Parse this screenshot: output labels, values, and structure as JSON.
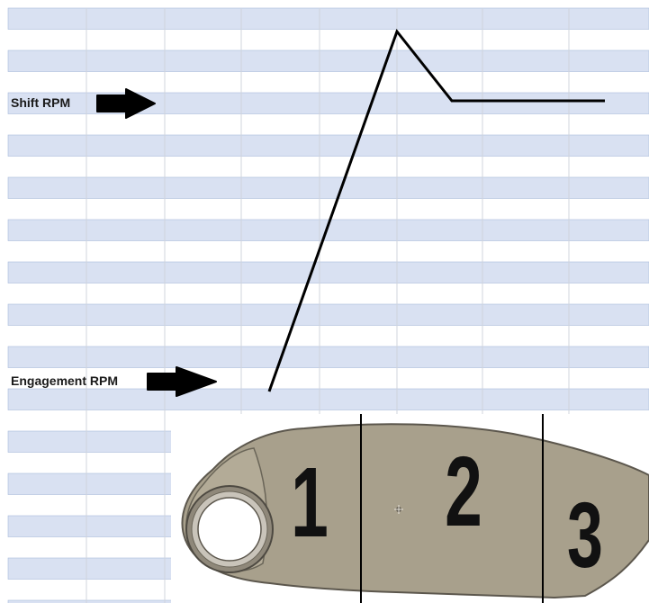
{
  "labels": {
    "shift_rpm": "Shift RPM",
    "engagement_rpm": "Engagement RPM"
  },
  "zones": {
    "zone1": "1",
    "zone2": "2",
    "zone3": "3"
  },
  "colors": {
    "band_blue": "#d9e1f2",
    "band_border": "#a9bbdb",
    "grid_line": "#d0d4dc",
    "curve": "#000000",
    "arrow": "#000000",
    "arm_fill": "#a8a08c",
    "arm_stroke": "#5c574d",
    "numeral": "#111111"
  },
  "icons": {
    "shift_arrow": "arrow-right-icon",
    "engagement_arrow": "arrow-right-icon"
  }
}
